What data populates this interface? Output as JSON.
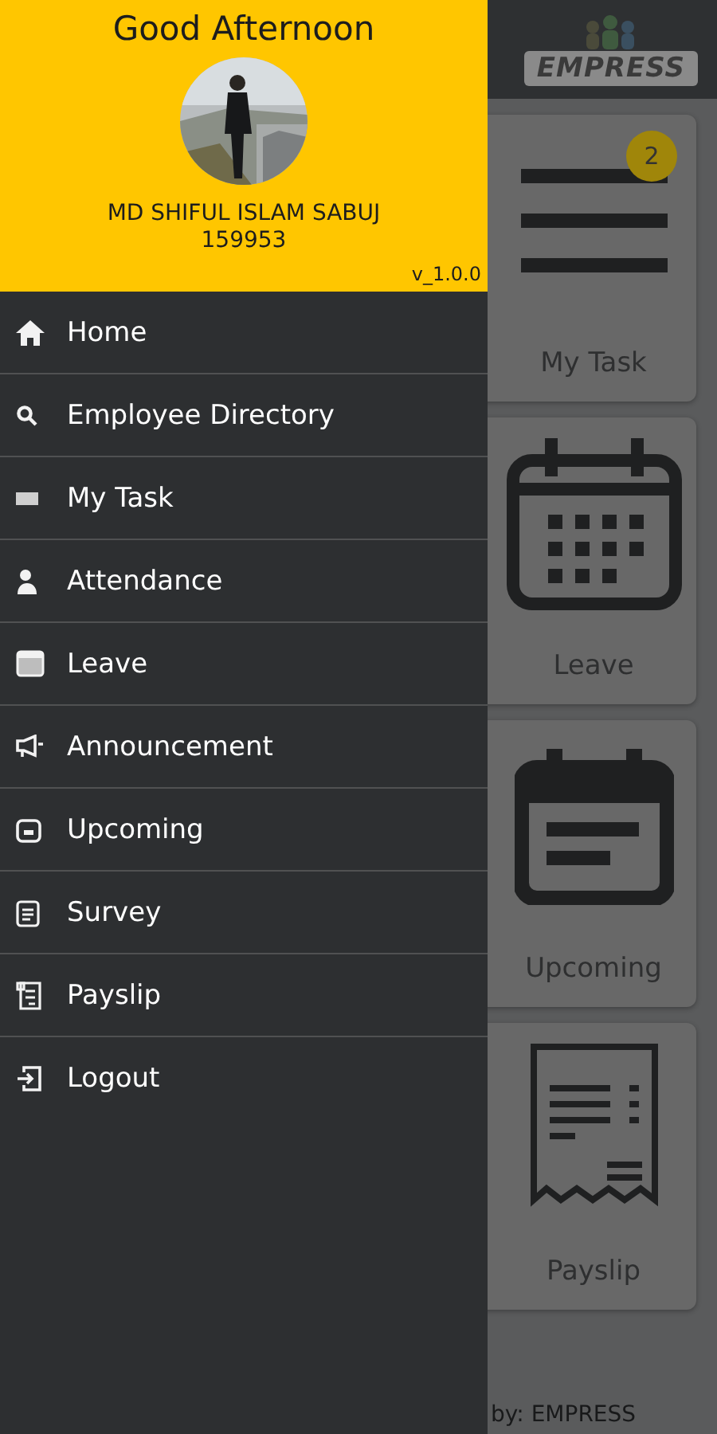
{
  "app_bar": {
    "logo_text": "EMPRESS"
  },
  "cards": [
    {
      "label": "My Task",
      "badge": "2"
    },
    {
      "label": "Leave"
    },
    {
      "label": "Upcoming"
    },
    {
      "label": "Payslip"
    }
  ],
  "footer": "by: EMPRESS",
  "drawer": {
    "greeting": "Good Afternoon",
    "user_name": "MD SHIFUL ISLAM SABUJ",
    "employee_id": "159953",
    "version": "v_1.0.0",
    "items": [
      {
        "label": "Home"
      },
      {
        "label": "Employee Directory"
      },
      {
        "label": "My Task"
      },
      {
        "label": "Attendance"
      },
      {
        "label": "Leave"
      },
      {
        "label": "Announcement"
      },
      {
        "label": "Upcoming"
      },
      {
        "label": "Survey"
      },
      {
        "label": "Payslip"
      },
      {
        "label": "Logout"
      }
    ]
  }
}
